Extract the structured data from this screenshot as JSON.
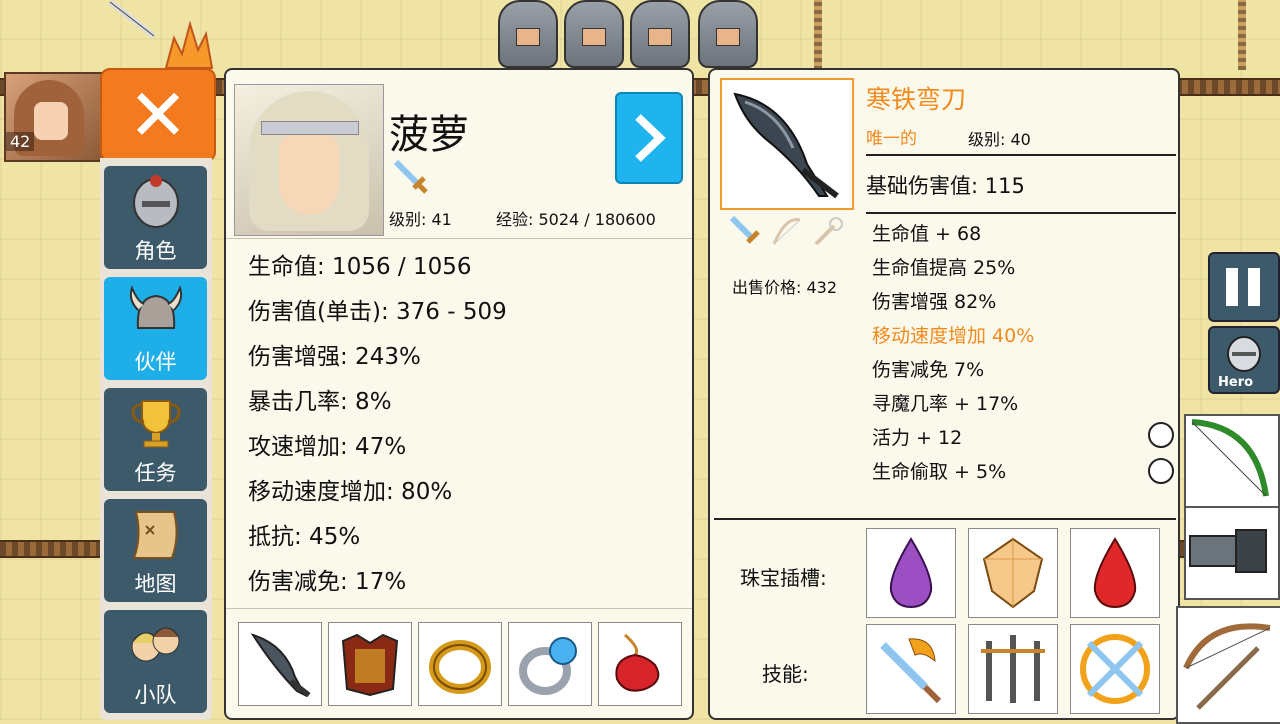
{
  "background": {
    "party_portrait_level": "42"
  },
  "nav": {
    "close_label": "✕",
    "tabs": [
      {
        "label": "角色",
        "icon": "knight-helmet-icon"
      },
      {
        "label": "伙伴",
        "icon": "horned-helmet-icon",
        "active": true
      },
      {
        "label": "任务",
        "icon": "trophy-icon"
      },
      {
        "label": "地图",
        "icon": "map-scroll-icon"
      },
      {
        "label": "小队",
        "icon": "party-icon"
      }
    ]
  },
  "character": {
    "name": "菠萝",
    "level_text": "级别: 41",
    "exp_text": "经验: 5024 / 180600",
    "next_label": ">",
    "stats": [
      "生命值: 1056 / 1056",
      "伤害值(单击): 376 - 509",
      "伤害增强: 243%",
      "暴击几率: 8%",
      "攻速增加: 47%",
      "移动速度增加: 80%",
      "抵抗: 45%",
      "伤害减免: 17%"
    ],
    "equipment": [
      "scythe-blade-icon",
      "chest-armor-icon",
      "gold-ring-icon",
      "sapphire-ring-icon",
      "red-amulet-icon"
    ]
  },
  "item": {
    "name": "寒铁弯刀",
    "rarity": "唯一的",
    "level_text": "级别: 40",
    "base_damage": "基础伤害值: 115",
    "sell_price": "出售价格: 432",
    "affixes": [
      {
        "text": "生命值 + 68",
        "highlight": false
      },
      {
        "text": "生命值提高 25%",
        "highlight": false
      },
      {
        "text": "伤害增强 82%",
        "highlight": false
      },
      {
        "text": "移动速度增加 40%",
        "highlight": true
      },
      {
        "text": "伤害减免 7%",
        "highlight": false
      },
      {
        "text": "寻魔几率 + 17%",
        "highlight": false
      },
      {
        "text": "活力 + 12",
        "highlight": false
      },
      {
        "text": "生命偷取 + 5%",
        "highlight": false
      }
    ],
    "gem_label": "珠宝插槽:",
    "skill_label": "技能:",
    "gems": [
      "purple-gem-icon",
      "topaz-gem-icon",
      "ruby-gem-icon"
    ],
    "skills": [
      "flame-sword-skill-icon",
      "triple-sword-skill-icon",
      "crossed-blades-skill-icon"
    ]
  },
  "hud": {
    "hero_label": "Hero"
  },
  "colors": {
    "accent_orange": "#f47a1f",
    "accent_blue": "#1eaee8",
    "nav_dark": "#3d5a6a",
    "unique_text": "#f28a1c"
  }
}
